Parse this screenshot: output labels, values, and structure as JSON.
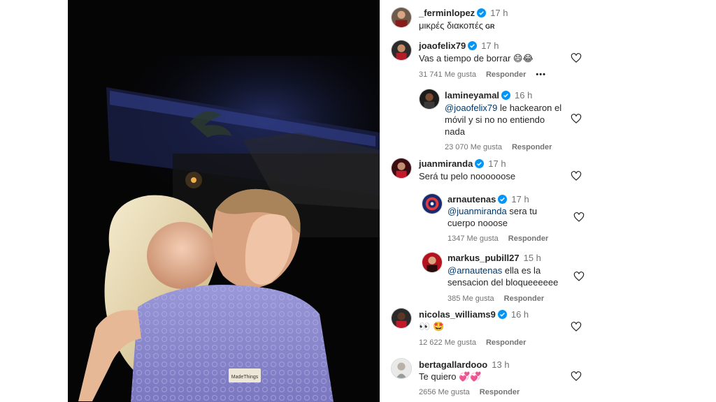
{
  "post_photo": {
    "alt": "",
    "shirt_tag": "MadeThings"
  },
  "caption": {
    "username": "_ferminlopez",
    "time": "17 h",
    "text": "μικρές διακοπές",
    "flag_text": "GR"
  },
  "comments": [
    {
      "username": "joaofelix79",
      "time": "17 h",
      "text": "Vas a tiempo de borrar",
      "emoji": "😄😂",
      "likes": "31 741 Me gusta",
      "reply_label": "Responder",
      "more_label": "•••"
    },
    {
      "username": "lamineyamal",
      "time": "16 h",
      "mention": "@joaofelix79",
      "text_line1": " le hackearon el",
      "text_line2": "móvil y si no no entiendo",
      "text_line3": "nada",
      "likes": "23 070 Me gusta",
      "reply_label": "Responder"
    },
    {
      "username": "juanmiranda",
      "time": "17 h",
      "text": "Será tu pelo noooooose"
    },
    {
      "username": "arnautenas",
      "time": "17 h",
      "mention": "@juanmiranda",
      "text_line1": " sera tu",
      "text_line2": "cuerpo nooose",
      "likes": "1347 Me gusta",
      "reply_label": "Responder"
    },
    {
      "username": "markus_pubill27",
      "time": "15 h",
      "mention": "@arnautenas",
      "text_line1": " ella es la",
      "text_line2": "sensacion del bloqueeeeee",
      "likes": "385 Me gusta",
      "reply_label": "Responder"
    },
    {
      "username": "nicolas_williams9",
      "time": "16 h",
      "emoji": "👀 🤩",
      "likes": "12 622 Me gusta",
      "reply_label": "Responder"
    },
    {
      "username": "bertagallardooo",
      "time": "13 h",
      "text": "Te quiero",
      "emoji": "💞💞",
      "likes": "2656 Me gusta",
      "reply_label": "Responder"
    }
  ],
  "colors": {
    "verified": "#0095f6",
    "muted_text": "#737373",
    "mention": "#00376b",
    "photo_background": "#050506"
  }
}
